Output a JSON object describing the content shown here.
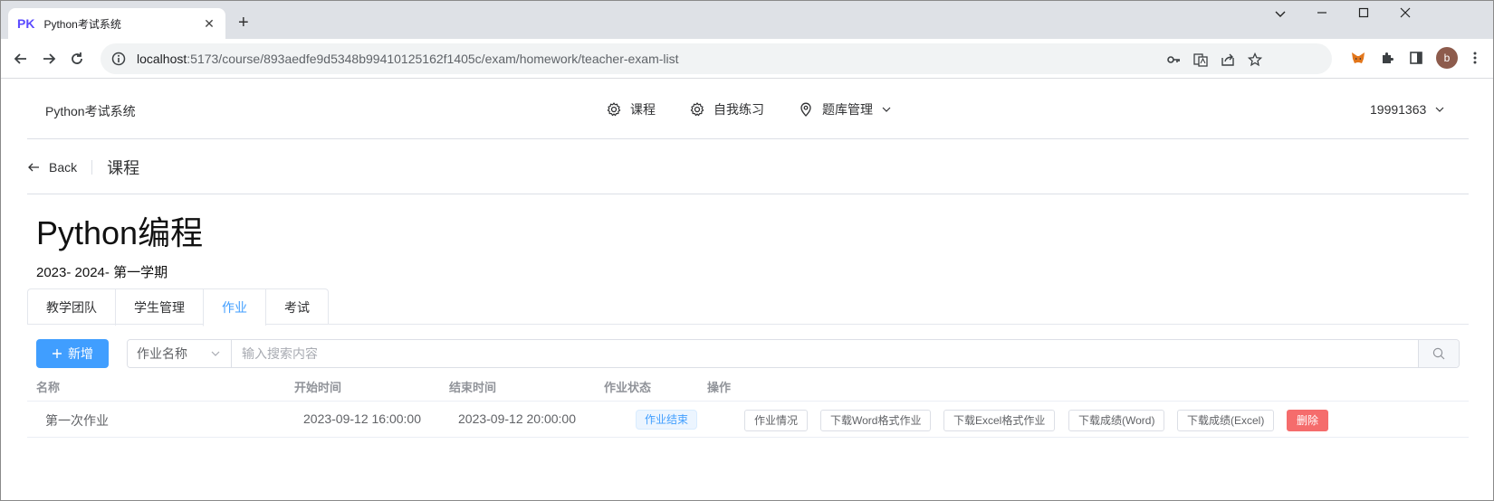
{
  "browser": {
    "tab_favicon": "PK",
    "tab_title": "Python考试系统",
    "url_host": "localhost",
    "url_rest": ":5173/course/893aedfe9d5348b99410125162f1405c/exam/homework/teacher-exam-list",
    "profile_initial": "b"
  },
  "nav": {
    "brand": "Python考试系统",
    "menu": {
      "course": "课程",
      "practice": "自我练习",
      "bank": "题库管理"
    },
    "user": "19991363"
  },
  "page_header": {
    "back": "Back",
    "title": "课程"
  },
  "course": {
    "title": "Python编程",
    "term": "2023- 2024- 第一学期"
  },
  "tabs": {
    "team": "教学团队",
    "students": "学生管理",
    "homework": "作业",
    "exam": "考试",
    "active": "作业"
  },
  "toolbar": {
    "add_label": "新增",
    "search_field": "作业名称",
    "search_placeholder": "输入搜索内容"
  },
  "table": {
    "headers": {
      "name": "名称",
      "start": "开始时间",
      "end": "结束时间",
      "status": "作业状态",
      "ops": "操作"
    },
    "rows": [
      {
        "name": "第一次作业",
        "start": "2023-09-12 16:00:00",
        "end": "2023-09-12 20:00:00",
        "status": "作业结束",
        "actions": {
          "detail": "作业情况",
          "download_word": "下载Word格式作业",
          "download_excel": "下载Excel格式作业",
          "grades_word": "下载成绩(Word)",
          "grades_excel": "下载成绩(Excel)",
          "delete": "删除"
        }
      }
    ]
  },
  "colors": {
    "primary": "#409eff",
    "danger": "#f56c6c",
    "status_bg": "#ecf5ff"
  }
}
